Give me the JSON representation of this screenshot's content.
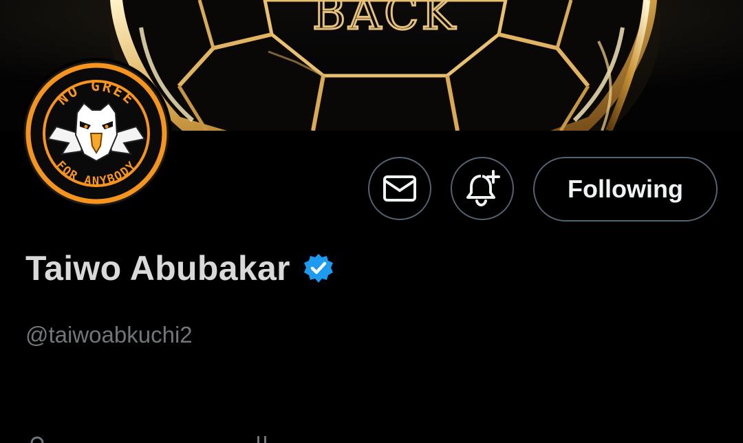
{
  "banner": {
    "visible_text": "BACK"
  },
  "avatar": {
    "top_text": "NO GREE",
    "bottom_text": "FOR ANYBODY",
    "accent_color": "#f7941d"
  },
  "actions": {
    "message_icon": "envelope-icon",
    "notify_icon": "bell-plus-icon",
    "following_label": "Following"
  },
  "profile": {
    "display_name": "Taiwo Abubakar",
    "verified": true,
    "verified_color": "#1d9bf0",
    "handle": "@taiwoabkuchi2"
  },
  "colors": {
    "background": "#000000",
    "button_border": "#536471",
    "name_text": "#d9d9d9",
    "handle_text": "#71767b",
    "gold": "#d4a24a"
  }
}
